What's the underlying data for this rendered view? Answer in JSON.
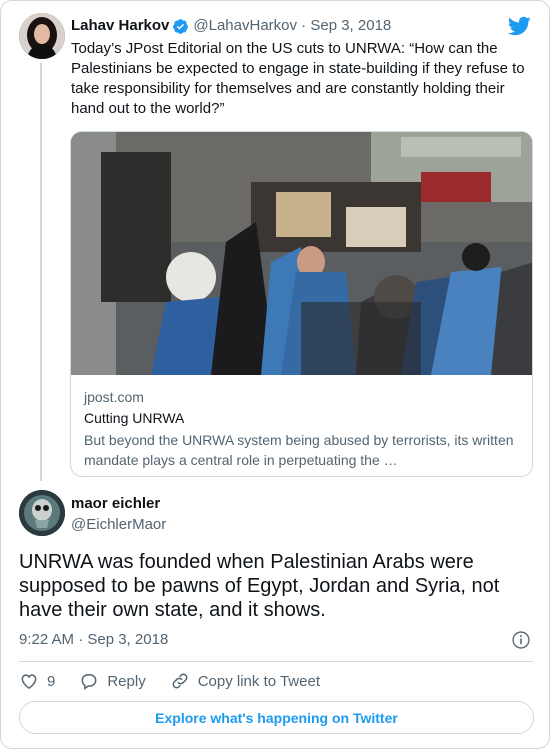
{
  "colors": {
    "accent": "#1d9bf0",
    "text": "#0f1419",
    "muted": "#536471",
    "border": "#cfd9de"
  },
  "parent_tweet": {
    "name": "Lahav Harkov",
    "handle": "@LahavHarkov",
    "separator": " · ",
    "date": "Sep 3, 2018",
    "text": "Today’s JPost Editorial on the US cuts to UNRWA: “How can the Palestinians be expected to engage in state-building if they refuse to take responsibility for themselves and are constantly holding their hand out to the world?”",
    "avatar_icon": "avatar-photo",
    "link_card": {
      "domain": "jpost.com",
      "title": "Cutting UNRWA",
      "description": "But beyond the UNRWA system being abused by terrorists, its written mandate plays a central role in perpetuating the …"
    }
  },
  "main_tweet": {
    "name": "maor eichler",
    "handle": "@EichlerMaor",
    "text": "UNRWA was founded when Palestinian Arabs were supposed to be pawns of Egypt, Jordan and Syria, not have their own state, and it shows.",
    "time": "9:22 AM",
    "separator": " · ",
    "date": "Sep 3, 2018"
  },
  "actions": {
    "like_count": "9",
    "reply_label": "Reply",
    "copy_link_label": "Copy link to Tweet"
  },
  "explore_label": "Explore what's happening on Twitter",
  "icons": [
    "verified-badge-icon",
    "twitter-bird-icon",
    "info-icon",
    "heart-icon",
    "reply-icon",
    "link-icon"
  ]
}
